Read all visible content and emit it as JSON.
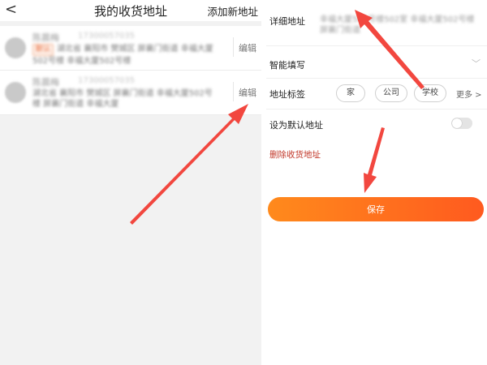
{
  "left": {
    "back_glyph": "<",
    "title": "我的收货地址",
    "add_label": "添加新地址",
    "items": [
      {
        "name": "陈晨梅",
        "phone": "17300057035",
        "tag": "默认",
        "address": "湖北省 襄阳市 樊城区 屏襄门街道 幸福大厦502号楼 幸福大厦502号楼",
        "edit_label": "编辑"
      },
      {
        "name": "陈晨梅",
        "phone": "17300057035",
        "address": "湖北省 襄阳市 樊城区 屏襄门街道 幸福大厦502号楼 屏襄门街道 幸福大厦",
        "edit_label": "编辑"
      }
    ]
  },
  "right": {
    "detail_label": "详细地址",
    "detail_value": "幸福大厦502号楼502室 幸福大厦502号楼 屏襄门街道",
    "smart_fill_label": "智能填写",
    "tags_label": "地址标签",
    "tags": [
      "家",
      "公司",
      "学校"
    ],
    "more_label": "更多 >",
    "default_label": "设为默认地址",
    "delete_label": "删除收货地址",
    "save_label": "保存"
  },
  "colors": {
    "arrow": "#f2473f",
    "save_start": "#ff8a1c",
    "save_end": "#ff5a1f",
    "delete_text": "#c2392b"
  }
}
